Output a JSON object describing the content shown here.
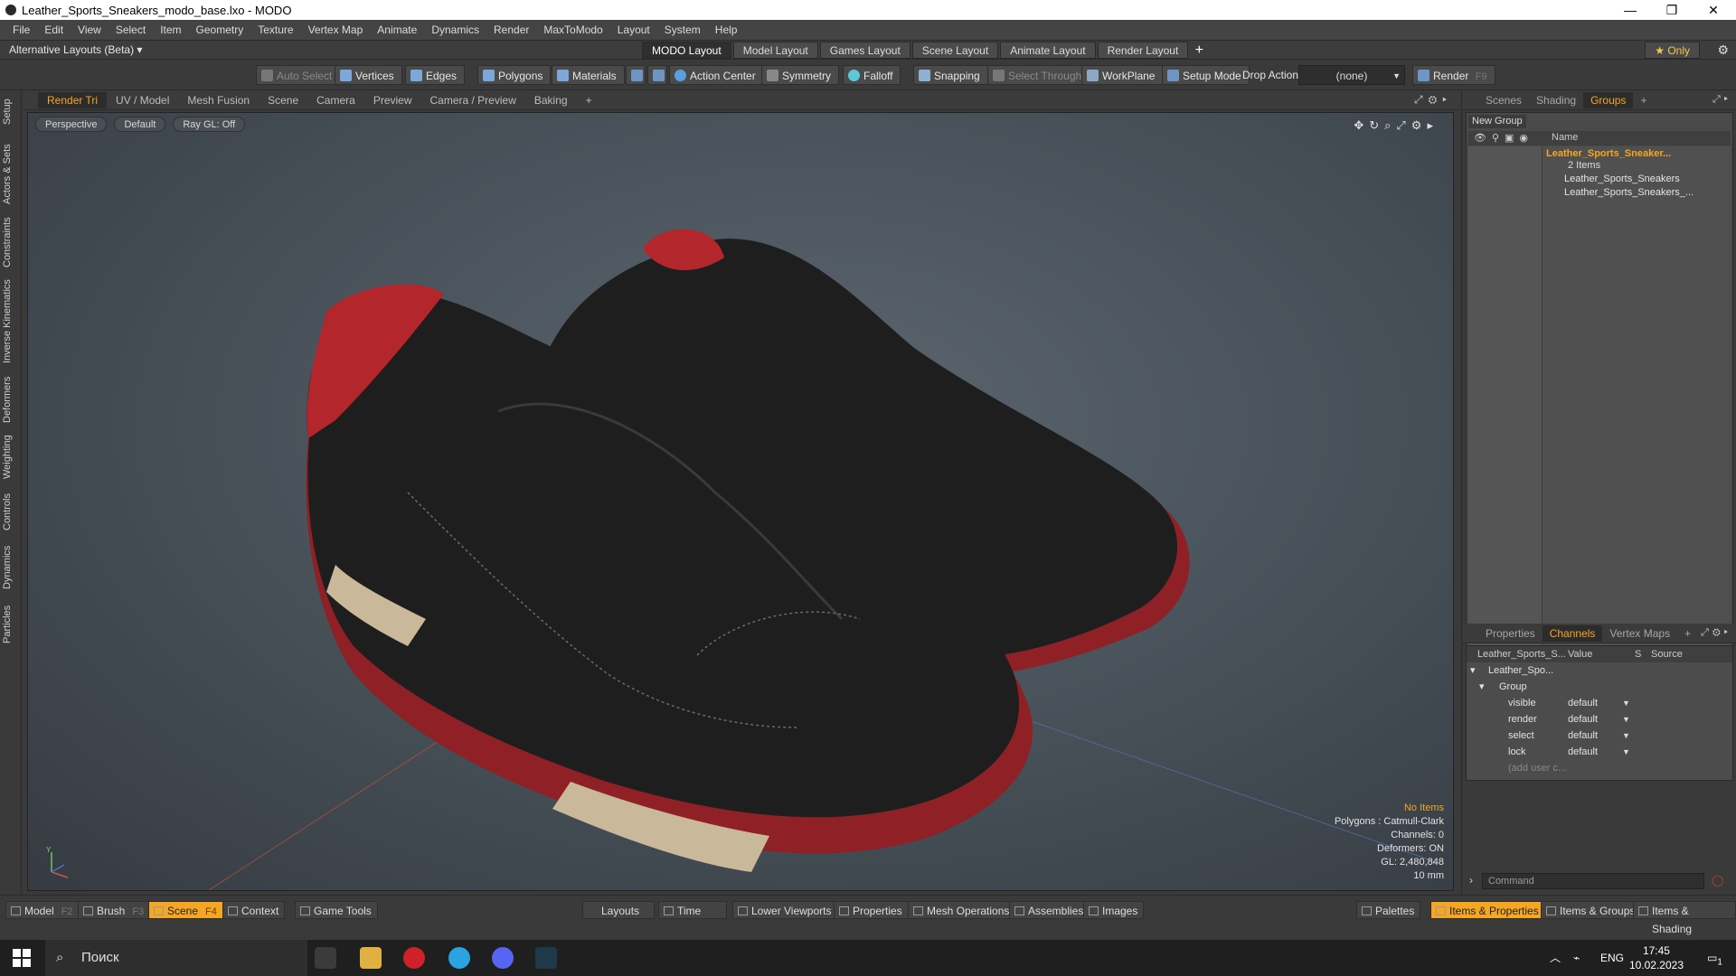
{
  "window": {
    "title": "Leather_Sports_Sneakers_modo_base.lxo - MODO",
    "controls": [
      "minimize",
      "restore",
      "close"
    ]
  },
  "menu": [
    "File",
    "Edit",
    "View",
    "Select",
    "Item",
    "Geometry",
    "Texture",
    "Vertex Map",
    "Animate",
    "Dynamics",
    "Render",
    "MaxToModo",
    "Layout",
    "System",
    "Help"
  ],
  "layoutbar": {
    "alt_layouts": "Alternative Layouts (Beta) ▾",
    "tabs": [
      "MODO Layout",
      "Model Layout",
      "Games Layout",
      "Scene Layout",
      "Animate Layout",
      "Render Layout"
    ],
    "active_tab": "MODO Layout",
    "only_label": "★  Only"
  },
  "toolbar": {
    "auto_select": "Auto Select",
    "vertices": "Vertices",
    "edges": "Edges",
    "polygons": "Polygons",
    "materials": "Materials",
    "action_center": "Action Center",
    "symmetry": "Symmetry",
    "falloff": "Falloff",
    "snapping": "Snapping",
    "select_through": "Select Through",
    "workplane": "WorkPlane",
    "setup_mode": "Setup Mode",
    "drop_action": "Drop Action",
    "drop_action_value": "(none)",
    "render": "Render",
    "render_key": "F9"
  },
  "left_tabs": [
    "Setup",
    "Actors & Sets",
    "Constraints",
    "Inverse Kinematics",
    "Deformers",
    "Weighting",
    "Controls",
    "Dynamics",
    "Particles"
  ],
  "viewport_tabs": [
    "Render Tri",
    "UV / Model",
    "Mesh Fusion",
    "Scene",
    "Camera",
    "Preview",
    "Camera / Preview",
    "Baking"
  ],
  "viewport": {
    "projection": "Perspective",
    "shading": "Default",
    "raygl": "Ray GL: Off",
    "info": {
      "items": "No Items",
      "polygons": "Polygons : Catmull-Clark",
      "channels": "Channels: 0",
      "deformers": "Deformers: ON",
      "gl": "GL: 2,480,848",
      "scale": "10 mm"
    },
    "axis_label": "Y"
  },
  "groups_panel": {
    "tabs": [
      "Scenes",
      "Shading",
      "Groups"
    ],
    "active_tab": "Groups",
    "new_group": "New Group",
    "name_header": "Name",
    "root": "Leather_Sports_Sneaker...",
    "root_count": "2 Items",
    "children": [
      "Leather_Sports_Sneakers",
      "Leather_Sports_Sneakers_..."
    ]
  },
  "channels_panel": {
    "tabs": [
      "Properties",
      "Channels",
      "Vertex Maps"
    ],
    "active_tab": "Channels",
    "headers": [
      "Leather_Sports_S...",
      "Value",
      "S",
      "Source"
    ],
    "item": "Leather_Spo...",
    "group": "Group",
    "rows": [
      {
        "name": "visible",
        "value": "default"
      },
      {
        "name": "render",
        "value": "default"
      },
      {
        "name": "select",
        "value": "default"
      },
      {
        "name": "lock",
        "value": "default"
      }
    ],
    "add_user": "(add user c...",
    "command_placeholder": "Command"
  },
  "bottombar": {
    "model": "Model",
    "model_key": "F2",
    "brush": "Brush",
    "brush_key": "F3",
    "scene": "Scene",
    "scene_key": "F4",
    "context": "Context",
    "game_tools": "Game Tools",
    "layouts": "Layouts",
    "time": "Time",
    "lower_viewports": "Lower Viewports",
    "properties": "Properties",
    "mesh_operations": "Mesh Operations",
    "assemblies": "Assemblies",
    "images": "Images",
    "palettes": "Palettes",
    "items_properties": "Items & Properties",
    "items_groups": "Items & Groups",
    "items_shading": "Items & Shading"
  },
  "taskbar": {
    "search": "Поиск",
    "lang": "ENG",
    "time": "17:45",
    "date": "10.02.2023",
    "notifications": "1"
  },
  "colors": {
    "accent": "#f5a623",
    "shoe_upper": "#1e1e1e",
    "shoe_lining": "#b3262b",
    "shoe_sole": "#8f2026",
    "shoe_heel_insert": "#c9b99a"
  }
}
